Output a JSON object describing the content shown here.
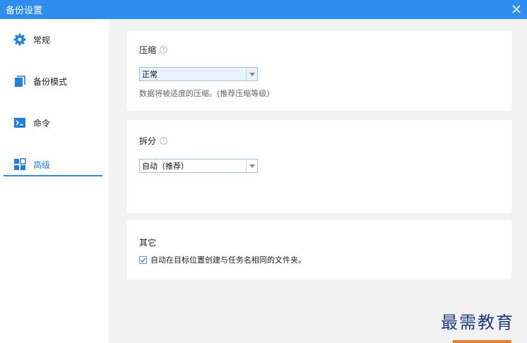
{
  "window": {
    "title": "备份设置"
  },
  "sidebar": {
    "items": [
      {
        "label": "常规",
        "icon": "gear-icon"
      },
      {
        "label": "备份模式",
        "icon": "backup-mode-icon"
      },
      {
        "label": "命令",
        "icon": "terminal-icon"
      },
      {
        "label": "高级",
        "icon": "grid-icon",
        "active": true
      }
    ]
  },
  "compression": {
    "heading": "压缩",
    "selected": "正常",
    "hint": "数据将被适度的压缩。(推荐压缩等级)"
  },
  "split": {
    "heading": "拆分",
    "selected": "自动（推荐）"
  },
  "other": {
    "heading": "其它",
    "checkbox_label": "自动在目标位置创建与任务名相同的文件夹。",
    "checked": true
  },
  "watermark": "最需教育",
  "colors": {
    "accent": "#2e8ef0",
    "title_bar": "#2e8ef0",
    "content_bg": "#f2f2f2",
    "watermark": "#1a3a8a",
    "orange": "#f07a28"
  }
}
